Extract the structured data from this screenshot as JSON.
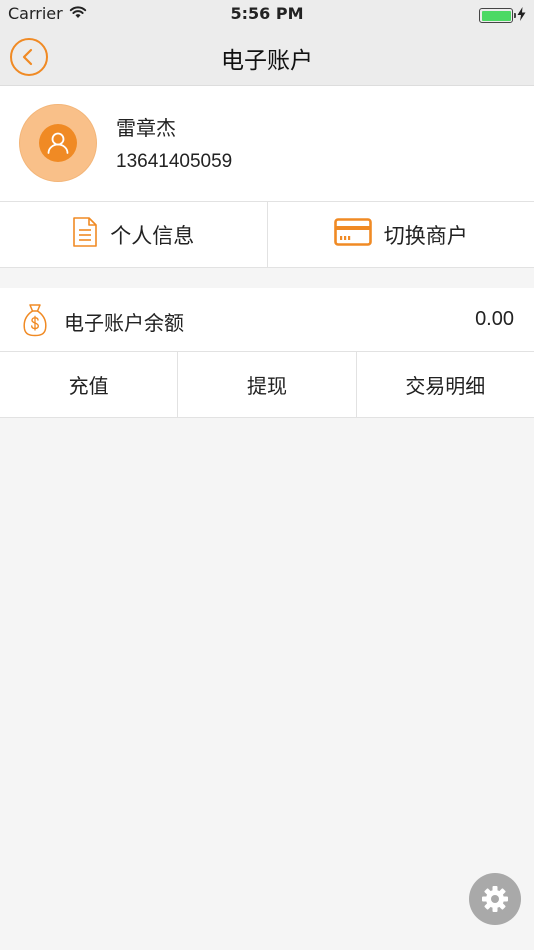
{
  "status_bar": {
    "carrier": "Carrier",
    "time": "5:56 PM",
    "battery_level": 1.0,
    "battery_color": "#4cd964",
    "icons": [
      "wifi-icon",
      "battery-icon",
      "charging-icon"
    ]
  },
  "nav": {
    "title": "电子账户",
    "back_icon": "chevron-left-icon"
  },
  "profile": {
    "name": "雷章杰",
    "phone": "13641405059",
    "avatar_icon": "user-icon"
  },
  "actions": [
    {
      "label": "个人信息",
      "icon": "document-icon"
    },
    {
      "label": "切换商户",
      "icon": "card-icon"
    }
  ],
  "balance": {
    "label": "电子账户余额",
    "value": "0.00",
    "icon": "money-bag-icon"
  },
  "operations": [
    {
      "label": "充值"
    },
    {
      "label": "提现"
    },
    {
      "label": "交易明细"
    }
  ],
  "settings": {
    "icon": "gear-icon"
  },
  "colors": {
    "accent": "#f08a24",
    "avatar_bg": "#f9c089",
    "page_bg": "#f5f5f5",
    "nav_bg": "#ececec",
    "fab_bg": "#a9a9a9"
  }
}
